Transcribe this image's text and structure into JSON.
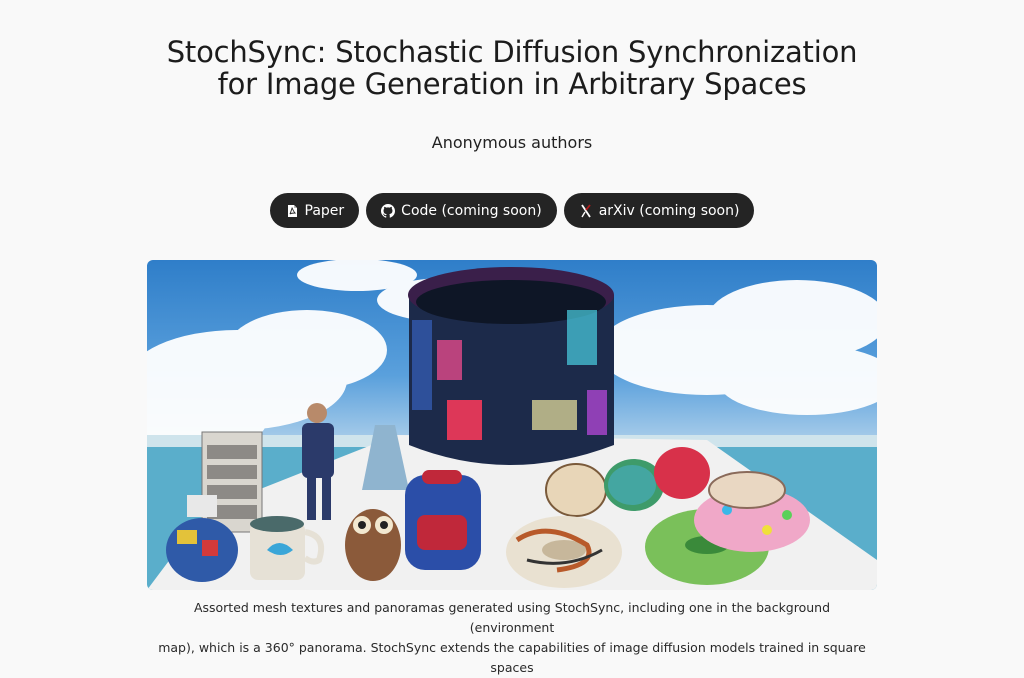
{
  "header": {
    "title_line1": "StochSync: Stochastic Diffusion Synchronization",
    "title_line2": "for Image Generation in Arbitrary Spaces",
    "authors": "Anonymous authors"
  },
  "links": [
    {
      "label": "Paper",
      "icon": "pdf-icon"
    },
    {
      "label": "Code (coming soon)",
      "icon": "github-icon"
    },
    {
      "label": "arXiv (coming soon)",
      "icon": "arxiv-icon"
    }
  ],
  "figure": {
    "caption_line1": "Assorted mesh textures and panoramas generated using StochSync, including one in the background (environment",
    "caption_line2": "map), which is a 360° panorama. StochSync extends the capabilities of image diffusion models trained in square spaces"
  },
  "colors": {
    "background": "#f9f9f9",
    "button_bg": "#242424",
    "button_text": "#ffffff"
  }
}
